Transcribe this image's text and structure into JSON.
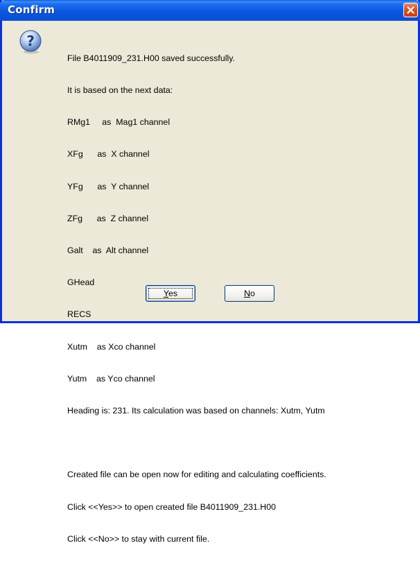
{
  "dialog": {
    "title": "Confirm",
    "icon": "question-icon",
    "lines": [
      "File B4011909_231.H00 saved successfully.",
      "It is based on the next data:",
      "RMg1     as  Mag1 channel",
      "XFg      as  X channel",
      "YFg      as  Y channel",
      "ZFg      as  Z channel",
      "Galt    as  Alt channel",
      "GHead",
      "RECS",
      "Xutm    as Xco channel",
      "Yutm    as Yco channel",
      "Heading is: 231. Its calculation was based on channels: Xutm, Yutm",
      "",
      "Created file can be open now for editing and calculating coefficients.",
      "Click <<Yes>> to open created file B4011909_231.H00",
      "Click <<No>> to stay with current file."
    ],
    "buttons": {
      "yes": {
        "mnemonic": "Y",
        "rest": "es"
      },
      "no": {
        "mnemonic": "N",
        "rest": "o"
      }
    }
  },
  "colors": {
    "titlebar": "#0a58e0",
    "face": "#ece9d8",
    "close": "#d9531e"
  }
}
